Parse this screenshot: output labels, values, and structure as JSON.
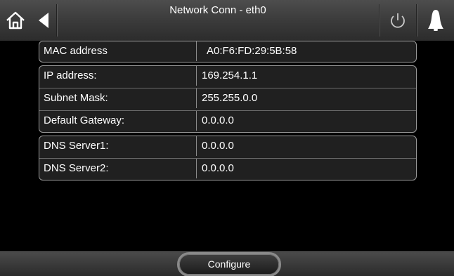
{
  "header": {
    "title": "Network Conn - eth0",
    "icons": [
      "home-icon",
      "back-icon",
      "power-icon",
      "bell-icon"
    ]
  },
  "groups": [
    {
      "rows": [
        {
          "label": "MAC address",
          "value": "A0:F6:FD:29:5B:58"
        }
      ]
    },
    {
      "rows": [
        {
          "label": "IP address:",
          "value": "169.254.1.1"
        },
        {
          "label": "Subnet Mask:",
          "value": "255.255.0.0"
        },
        {
          "label": "Default Gateway:",
          "value": "0.0.0.0"
        }
      ]
    },
    {
      "rows": [
        {
          "label": "DNS Server1:",
          "value": "0.0.0.0"
        },
        {
          "label": "DNS Server2:",
          "value": "0.0.0.0"
        }
      ]
    }
  ],
  "footer": {
    "configure_label": "Configure"
  }
}
